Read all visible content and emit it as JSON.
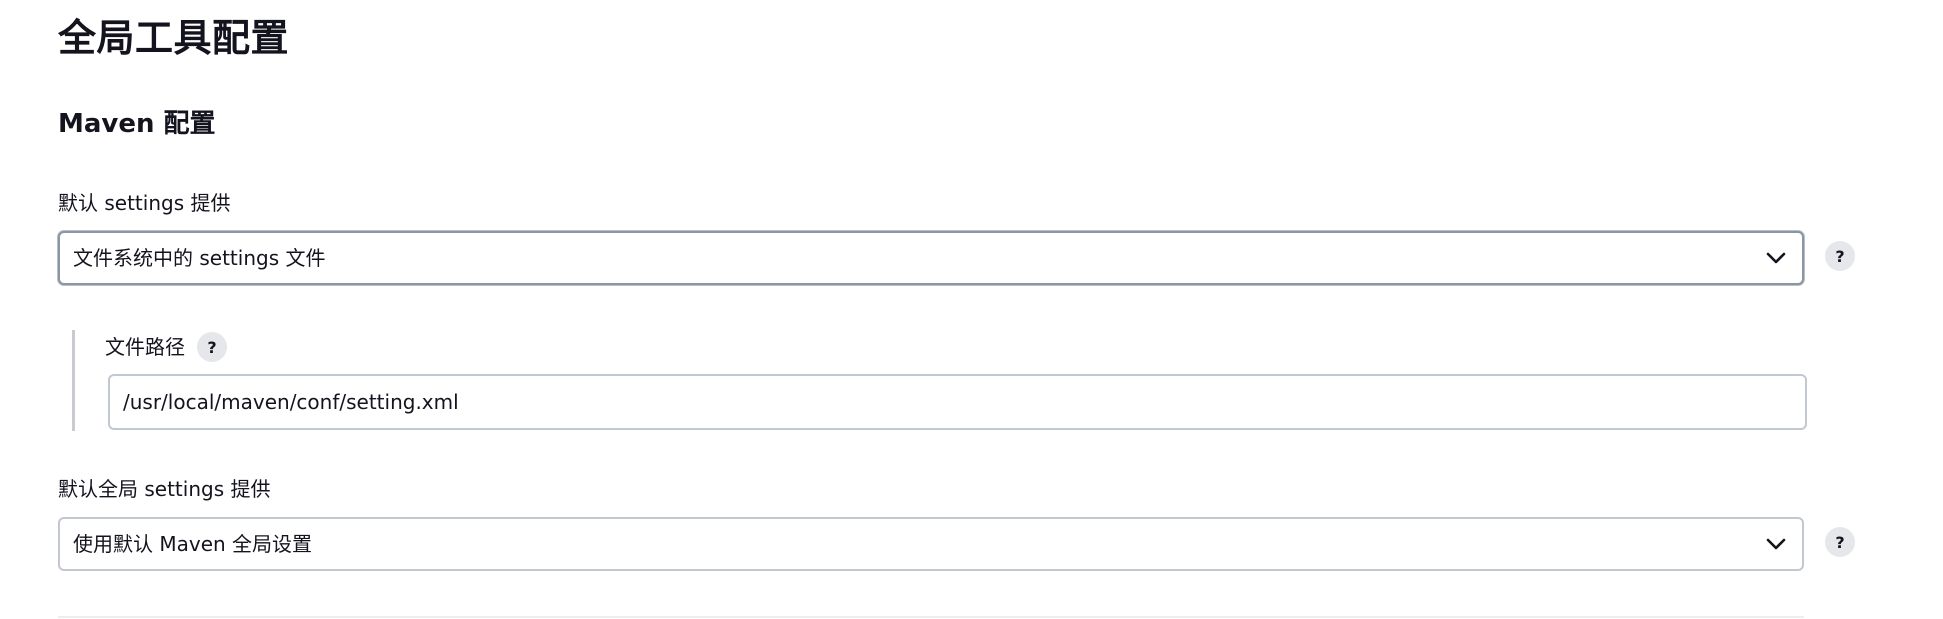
{
  "page": {
    "title": "全局工具配置"
  },
  "maven_section": {
    "title": "Maven 配置",
    "settings_provider": {
      "label": "默认 settings 提供",
      "selected": "文件系统中的 settings 文件",
      "help": "?"
    },
    "file_path": {
      "label": "文件路径",
      "help": "?",
      "value": "/usr/local/maven/conf/setting.xml"
    },
    "global_settings_provider": {
      "label": "默认全局 settings 提供",
      "selected": "使用默认 Maven 全局设置",
      "help": "?"
    }
  },
  "icons": {
    "dropdown": "chevron-down-icon",
    "help": "question-mark-help-icon"
  },
  "colors": {
    "text": "#14141f",
    "border": "#c2c8cf",
    "focused_border": "#8a96a3",
    "help_bg": "#e6e7ea"
  }
}
